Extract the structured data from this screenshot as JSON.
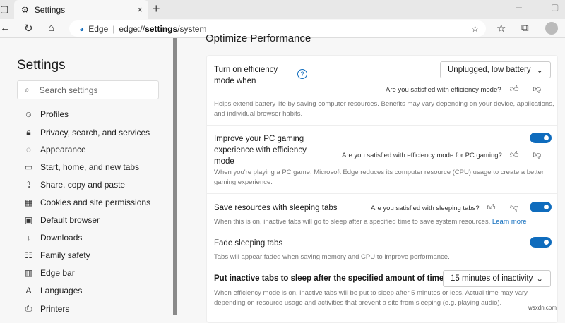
{
  "browser": {
    "tab_title": "Settings",
    "new_tab": "+",
    "close": "×",
    "brand": "Edge",
    "url_prefix": "edge://",
    "url_bold": "settings",
    "url_suffix": "/system"
  },
  "sidebar": {
    "title": "Settings",
    "search_placeholder": "Search settings",
    "items": [
      {
        "label": "Profiles",
        "icon": "profile-icon",
        "glyph": "☺"
      },
      {
        "label": "Privacy, search, and services",
        "icon": "lock-icon",
        "glyph": "🔒︎"
      },
      {
        "label": "Appearance",
        "icon": "palette-icon",
        "glyph": "◌"
      },
      {
        "label": "Start, home, and new tabs",
        "icon": "home-tabs-icon",
        "glyph": "▭"
      },
      {
        "label": "Share, copy and paste",
        "icon": "share-icon",
        "glyph": "⇪"
      },
      {
        "label": "Cookies and site permissions",
        "icon": "cookies-icon",
        "glyph": "▦"
      },
      {
        "label": "Default browser",
        "icon": "default-browser-icon",
        "glyph": "▣"
      },
      {
        "label": "Downloads",
        "icon": "download-icon",
        "glyph": "↓"
      },
      {
        "label": "Family safety",
        "icon": "family-icon",
        "glyph": "☷"
      },
      {
        "label": "Edge bar",
        "icon": "edge-bar-icon",
        "glyph": "▥"
      },
      {
        "label": "Languages",
        "icon": "languages-icon",
        "glyph": "A"
      },
      {
        "label": "Printers",
        "icon": "printer-icon",
        "glyph": "⎙"
      }
    ]
  },
  "main": {
    "section_title": "Optimize Performance",
    "efficiency": {
      "title_line1": "Turn on efficiency",
      "title_line2": "mode when",
      "select": "Unplugged, low battery",
      "question": "Are you satisfied with efficiency mode?",
      "desc_line1": "Helps extend battery life by saving computer resources. Benefits may vary depending on your device, applications,",
      "desc_line2": "and individual browser habits."
    },
    "gaming": {
      "title_line1": "Improve your PC gaming",
      "title_line2": "experience with efficiency",
      "title_line3": "mode",
      "question": "Are you satisfied with efficiency mode for PC gaming?",
      "desc_line1": "When you're playing a PC game, Microsoft Edge reduces its computer resource (CPU) usage to create a better",
      "desc_line2": "gaming experience.",
      "enabled": true
    },
    "sleeping": {
      "title": "Save resources with sleeping tabs",
      "question": "Are you satisfied with sleeping tabs?",
      "desc": "When this is on, inactive tabs will go to sleep after a specified time to save system resources.",
      "link": "Learn more",
      "enabled": true
    },
    "fade": {
      "title": "Fade sleeping tabs",
      "desc": "Tabs will appear faded when saving memory and CPU to improve performance.",
      "enabled": true
    },
    "inactive": {
      "title": "Put inactive tabs to sleep after the specified amount of time:",
      "select": "15 minutes of inactivity",
      "desc_line1": "When efficiency mode is on, inactive tabs will be put to sleep after 5 minutes or less. Actual time may vary",
      "desc_line2": "depending on resource usage and activities that prevent a site from sleeping (e.g. playing audio)."
    }
  },
  "colors": {
    "accent": "#0f6cbd"
  }
}
